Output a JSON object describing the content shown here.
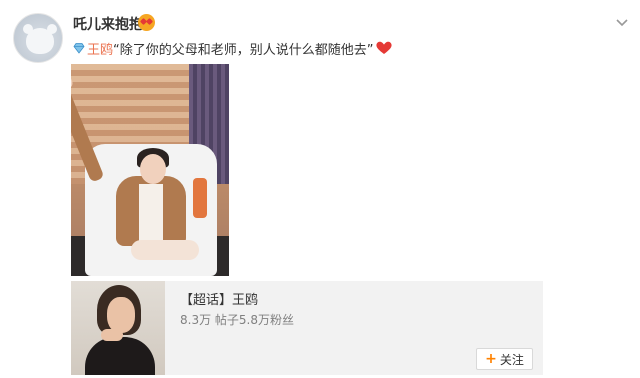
{
  "post": {
    "username": "吒儿来抱抱",
    "mention": "王鸥",
    "text": "“除了你的父母和老师，别人说什么都随他去”",
    "icons": {
      "badge_emoji": "heart-eyes-emoji-icon",
      "more": "chevron-down-icon",
      "super_topic": "diamond-icon",
      "end": "red-heart-icon"
    },
    "colors": {
      "mention": "#eb7350",
      "heart": "#e53935",
      "follow_plus": "#ff8200"
    }
  },
  "card": {
    "title": "【超话】王鸥",
    "stats": "8.3万 帖子5.8万粉丝",
    "follow_plus": "+",
    "follow_label": "关注"
  }
}
